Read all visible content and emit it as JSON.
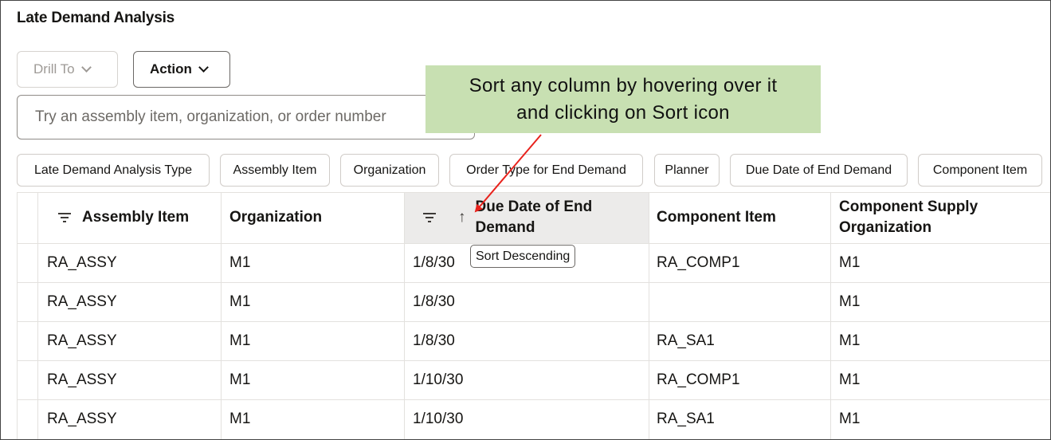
{
  "page": {
    "title": "Late Demand Analysis"
  },
  "toolbar": {
    "drill_label": "Drill To",
    "action_label": "Action"
  },
  "search": {
    "placeholder": "Try an assembly item, organization, or order number"
  },
  "callout": {
    "line1": "Sort any column by hovering over it",
    "line2": "and clicking on Sort icon"
  },
  "filter_chips": [
    "Late Demand Analysis Type",
    "Assembly Item",
    "Organization",
    "Order Type for End Demand",
    "Planner",
    "Due Date of End Demand",
    "Component Item"
  ],
  "table": {
    "columns": [
      "Assembly Item",
      "Organization",
      [
        "Due Date of End",
        "Demand"
      ],
      "Component Item",
      [
        "Component Supply",
        "Organization"
      ]
    ],
    "rows": [
      [
        "RA_ASSY",
        "M1",
        "1/8/30",
        "RA_COMP1",
        "M1"
      ],
      [
        "RA_ASSY",
        "M1",
        "1/8/30",
        "",
        "M1"
      ],
      [
        "RA_ASSY",
        "M1",
        "1/8/30",
        "RA_SA1",
        "M1"
      ],
      [
        "RA_ASSY",
        "M1",
        "1/10/30",
        "RA_COMP1",
        "M1"
      ],
      [
        "RA_ASSY",
        "M1",
        "1/10/30",
        "RA_SA1",
        "M1"
      ]
    ]
  },
  "tooltip": {
    "text": "Sort Descending"
  },
  "colors": {
    "callout_bg": "#c8e0b2",
    "header_hover_bg": "#ecebea",
    "arrow": "#e8221c"
  },
  "icons": {
    "filter": "filter-lines-icon",
    "sort": "arrow-up-icon",
    "chevron": "chevron-down-icon"
  }
}
